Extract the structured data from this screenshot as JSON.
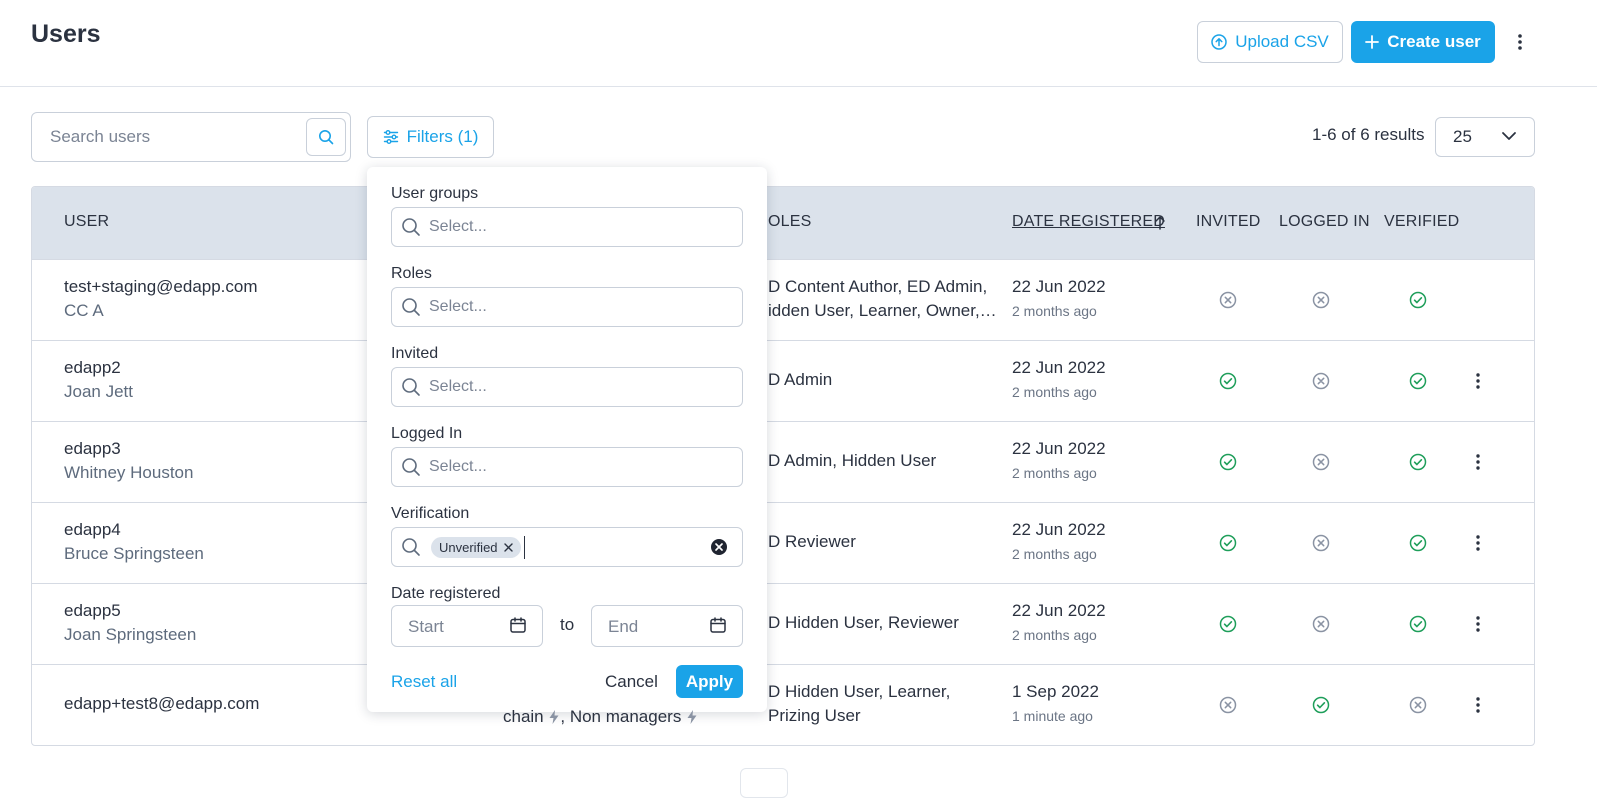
{
  "header": {
    "title": "Users",
    "upload_label": "Upload CSV",
    "create_label": "Create user"
  },
  "toolbar": {
    "search_placeholder": "Search users",
    "filters_label": "Filters (1)",
    "results_text": "1-6 of 6 results",
    "per_page": "25"
  },
  "table": {
    "headers": {
      "user": "USER",
      "roles": "OLES",
      "date_registered": "DATE REGISTERED",
      "invited": "INVITED",
      "logged_in": "LOGGED IN",
      "verified": "VERIFIED"
    },
    "rows": [
      {
        "user": "test+staging@edapp.com",
        "name": "CC A",
        "roles_line1": "D Content Author, ED Admin,",
        "roles_line2": "idden User, Learner, Owner,…",
        "date": "22 Jun 2022",
        "ago": "2 months ago",
        "invited": false,
        "logged_in": false,
        "verified": true,
        "menu": false
      },
      {
        "user": "edapp2",
        "name": "Joan Jett",
        "roles_line1": "D Admin",
        "roles_line2": "",
        "date": "22 Jun 2022",
        "ago": "2 months ago",
        "invited": true,
        "logged_in": false,
        "verified": true,
        "menu": true
      },
      {
        "user": "edapp3",
        "name": "Whitney Houston",
        "roles_line1": "D Admin, Hidden User",
        "roles_line2": "",
        "date": "22 Jun 2022",
        "ago": "2 months ago",
        "invited": true,
        "logged_in": false,
        "verified": true,
        "menu": true
      },
      {
        "user": "edapp4",
        "name": "Bruce Springsteen",
        "roles_line1": "D Reviewer",
        "roles_line2": "",
        "date": "22 Jun 2022",
        "ago": "2 months ago",
        "invited": true,
        "logged_in": false,
        "verified": true,
        "menu": true
      },
      {
        "user": "edapp5",
        "name": "Joan Springsteen",
        "roles_line1": "D Hidden User, Reviewer",
        "roles_line2": "",
        "date": "22 Jun 2022",
        "ago": "2 months ago",
        "invited": true,
        "logged_in": false,
        "verified": true,
        "menu": true
      },
      {
        "user": "edapp+test8@edapp.com",
        "name": "",
        "roles_line1": "D Hidden User, Learner,",
        "roles_line2": "Prizing User",
        "date": "1 Sep 2022",
        "ago": "1 minute ago",
        "invited": false,
        "logged_in": true,
        "verified": false,
        "menu": true
      }
    ],
    "group_fragment_a": "chain",
    "group_fragment_b": ", Non managers"
  },
  "filters": {
    "user_groups_label": "User groups",
    "roles_label": "Roles",
    "invited_label": "Invited",
    "logged_in_label": "Logged In",
    "verification_label": "Verification",
    "select_placeholder": "Select...",
    "verification_chip": "Unverified",
    "date_label": "Date registered",
    "start_placeholder": "Start",
    "to_label": "to",
    "end_placeholder": "End",
    "reset_label": "Reset all",
    "cancel_label": "Cancel",
    "apply_label": "Apply"
  },
  "colors": {
    "accent": "#1aa3e8",
    "header_bg": "#dbe2eb",
    "success": "#1e9e5a",
    "muted_icon": "#8a93a3"
  }
}
